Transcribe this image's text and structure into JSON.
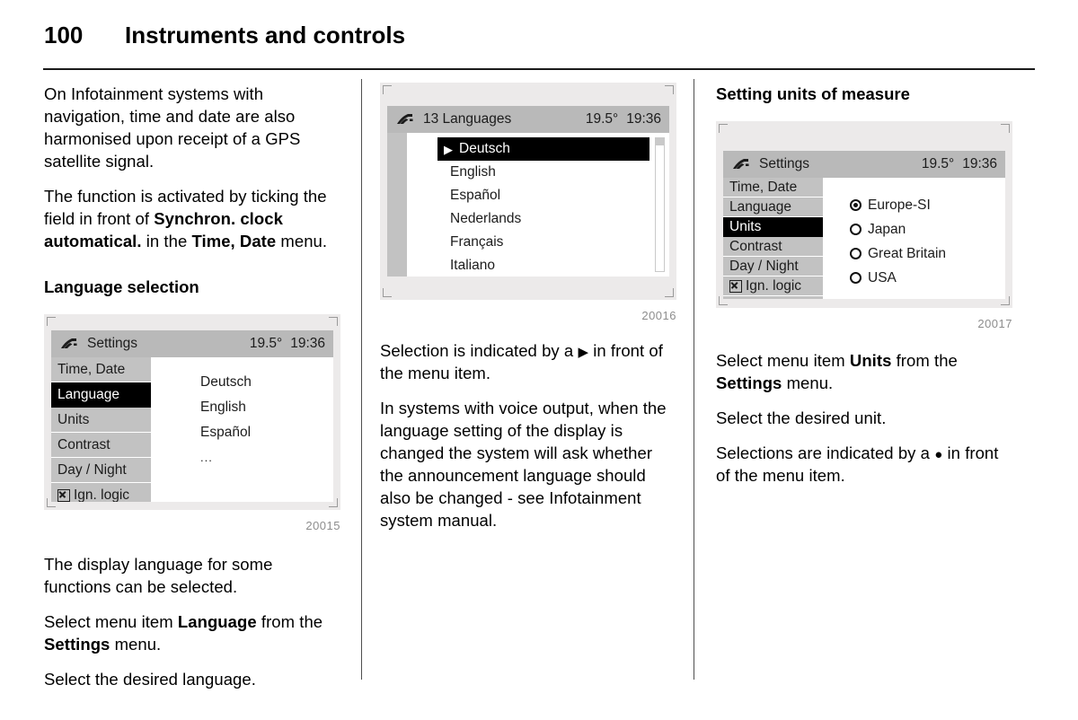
{
  "header": {
    "page_number": "100",
    "title": "Instruments and controls"
  },
  "column1": {
    "para1": "On Infotainment systems with navigation, time and date are also harmonised upon receipt of a GPS satellite signal.",
    "para2_a": "The function is activated by ticking the field in front of ",
    "para2_b": "Synchron. clock automatical.",
    "para2_c": " in the ",
    "para2_d": "Time, Date",
    "para2_e": " menu.",
    "heading": "Language selection",
    "figure": {
      "caption": "20015",
      "titlebar": {
        "icon": "settings-wrench-icon",
        "title": "Settings",
        "temperature": "19.5°",
        "time": "19:36"
      },
      "menu_items": [
        {
          "label": "Time, Date",
          "selected": false,
          "checkbox": false
        },
        {
          "label": "Language",
          "selected": true,
          "checkbox": false
        },
        {
          "label": "Units",
          "selected": false,
          "checkbox": false
        },
        {
          "label": "Contrast",
          "selected": false,
          "checkbox": false
        },
        {
          "label": "Day / Night",
          "selected": false,
          "checkbox": false
        },
        {
          "label": "Ign. logic",
          "selected": false,
          "checkbox": true
        }
      ],
      "values": [
        "Deutsch",
        "English",
        "Español",
        "..."
      ]
    },
    "para3": "The display language for some functions can be selected.",
    "para4_a": "Select menu item ",
    "para4_b": "Language",
    "para4_c": " from the ",
    "para4_d": "Settings",
    "para4_e": " menu.",
    "para5": "Select the desired language."
  },
  "column2": {
    "figure": {
      "caption": "20016",
      "titlebar": {
        "icon": "settings-wrench-icon",
        "title": "13 Languages",
        "temperature": "19.5°",
        "time": "19:36"
      },
      "list_items": [
        {
          "label": "Deutsch",
          "selected": true
        },
        {
          "label": "English",
          "selected": false
        },
        {
          "label": "Español",
          "selected": false
        },
        {
          "label": "Nederlands",
          "selected": false
        },
        {
          "label": "Français",
          "selected": false
        },
        {
          "label": "Italiano",
          "selected": false
        }
      ],
      "arrow_glyph": "▶"
    },
    "para1_a": "Selection is indicated by a ",
    "para1_glyph": "▶",
    "para1_b": " in front of the menu item.",
    "para2": "In systems with voice output, when the language setting of the display is changed the system will ask whether the announcement language should also be changed - see Infotainment system manual."
  },
  "column3": {
    "heading": "Setting units of measure",
    "figure": {
      "caption": "20017",
      "titlebar": {
        "icon": "settings-wrench-icon",
        "title": "Settings",
        "temperature": "19.5°",
        "time": "19:36"
      },
      "menu_items": [
        {
          "label": "Time, Date",
          "selected": false,
          "checkbox": false
        },
        {
          "label": "Language",
          "selected": false,
          "checkbox": false
        },
        {
          "label": "Units",
          "selected": true,
          "checkbox": false
        },
        {
          "label": "Contrast",
          "selected": false,
          "checkbox": false
        },
        {
          "label": "Day / Night",
          "selected": false,
          "checkbox": false
        },
        {
          "label": "Ign. logic",
          "selected": false,
          "checkbox": true
        }
      ],
      "radio_options": [
        {
          "label": "Europe-SI",
          "selected": true
        },
        {
          "label": "Japan",
          "selected": false
        },
        {
          "label": "Great Britain",
          "selected": false
        },
        {
          "label": "USA",
          "selected": false
        }
      ]
    },
    "para1_a": "Select menu item ",
    "para1_b": "Units",
    "para1_c": " from the ",
    "para1_d": "Settings",
    "para1_e": " menu.",
    "para2": "Select the desired unit.",
    "para3_a": "Selections are indicated by a ",
    "para3_glyph": "●",
    "para3_b": " in front of the menu item."
  },
  "colors": {
    "titlebar_gray": "#b9b9b9",
    "menu_gray": "#c2c2c2",
    "frame_gray": "#eceaea",
    "selected_black": "#000000",
    "caption_gray": "#8d8d8d"
  }
}
